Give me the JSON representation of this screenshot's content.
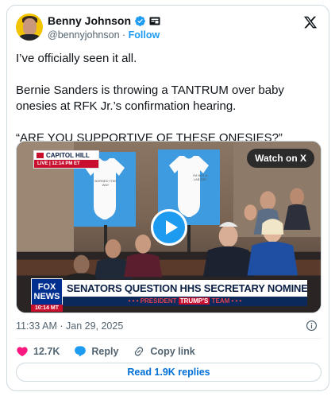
{
  "author": {
    "name": "Benny Johnson",
    "handle": "@bennyjohnson",
    "separator": " · ",
    "follow_label": "Follow"
  },
  "icons": {
    "verified": "verified-badge-icon",
    "affiliate": "affiliate-badge-icon",
    "platform": "x-logo-icon",
    "info": "info-icon",
    "like": "heart-icon",
    "reply": "reply-bubble-icon",
    "copy_link": "link-icon",
    "play": "play-icon"
  },
  "tweet": {
    "paragraphs": [
      "I’ve officially seen it all.",
      "Bernie Sanders is throwing a TANTRUM over baby onesies at RFK Jr.’s confirmation hearing.",
      "“ARE YOU SUPPORTIVE OF THESE ONESIES?”"
    ]
  },
  "media": {
    "watch_label": "Watch on X",
    "location_label": "CAPITOL HILL",
    "live_label": "LIVE | 12:14 PM ET",
    "network_line1": "FOX",
    "network_line2": "NEWS",
    "network_time": "10:14 MT",
    "headline": "SENATORS QUESTION HHS SECRETARY NOMINEE RFK JR",
    "subline_prefix": "• • • PRESIDENT ",
    "subline_name": "TRUMP'S",
    "subline_suffix": " TEAM • • •",
    "poster_text_1": "BORNED THIS WAY",
    "poster_text_2": "I'M NOT A LAB RAT"
  },
  "meta": {
    "timestamp": "11:33 AM · Jan 29, 2025"
  },
  "actions": {
    "likes_count": "12.7K",
    "reply_label": "Reply",
    "copy_link_label": "Copy link"
  },
  "read_replies_label": "Read 1.9K replies",
  "colors": {
    "accent": "#1d9bf0",
    "like": "#f91880",
    "link_text": "#006fd6",
    "secondary_text": "#536471",
    "border": "#cfd9de"
  }
}
